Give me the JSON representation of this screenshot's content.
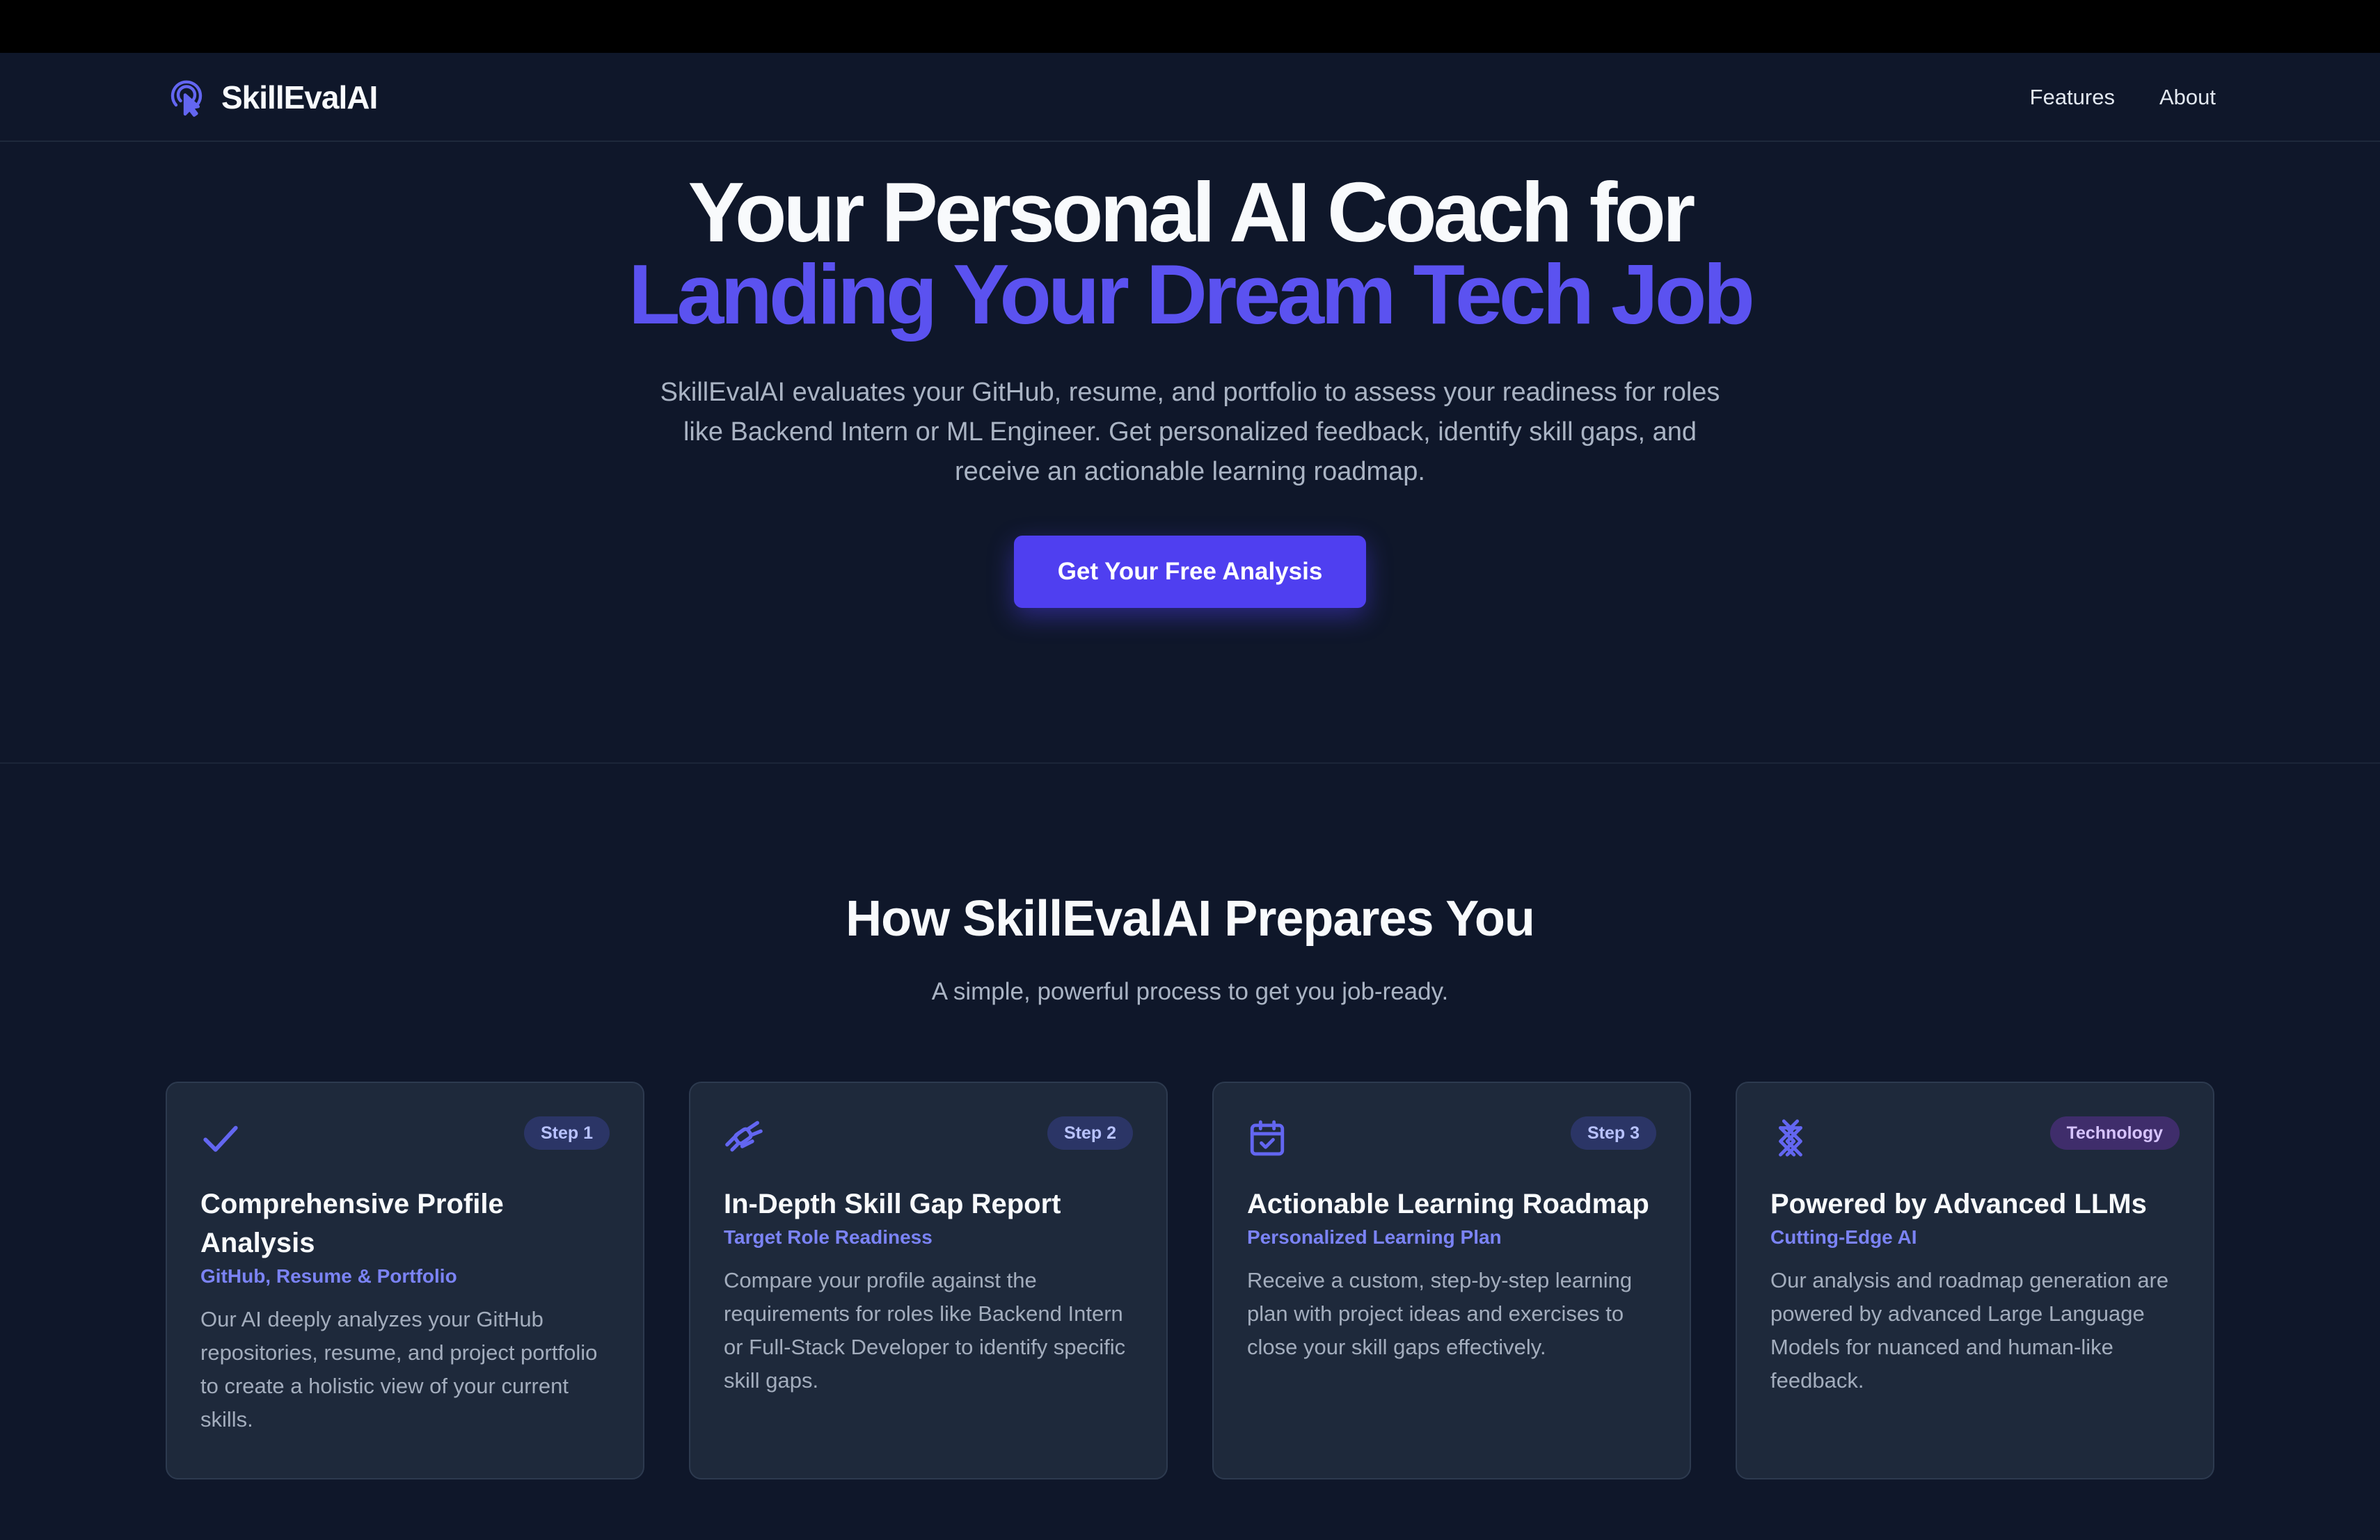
{
  "brand": {
    "name": "SkillEvalAI",
    "accent": "#5b52f0"
  },
  "nav": {
    "features": "Features",
    "about": "About"
  },
  "hero": {
    "title_line1": "Your Personal AI Coach for",
    "title_line2": "Landing Your Dream Tech Job",
    "subtitle": "SkillEvalAI evaluates your GitHub, resume, and portfolio to assess your readiness for roles like Backend Intern or ML Engineer. Get personalized feedback, identify skill gaps, and receive an actionable learning roadmap.",
    "cta": "Get Your Free Analysis"
  },
  "section": {
    "title": "How SkillEvalAI Prepares You",
    "subtitle": "A simple, powerful process to get you job-ready."
  },
  "cards": [
    {
      "icon": "check-icon",
      "badge": "Step 1",
      "title": "Comprehensive Profile Analysis",
      "subtitle": "GitHub, Resume & Portfolio",
      "body": "Our AI deeply analyzes your GitHub repositories, resume, and project portfolio to create a holistic view of your current skills."
    },
    {
      "icon": "satellite-icon",
      "badge": "Step 2",
      "title": "In-Depth Skill Gap Report",
      "subtitle": "Target Role Readiness",
      "body": "Compare your profile against the requirements for roles like Backend Intern or Full-Stack Developer to identify specific skill gaps."
    },
    {
      "icon": "calendar-check-icon",
      "badge": "Step 3",
      "title": "Actionable Learning Roadmap",
      "subtitle": "Personalized Learning Plan",
      "body": "Receive a custom, step-by-step learning plan with project ideas and exercises to close your skill gaps effectively."
    },
    {
      "icon": "neural-lattice-icon",
      "badge": "Technology",
      "title": "Powered by Advanced LLMs",
      "subtitle": "Cutting-Edge AI",
      "body": "Our analysis and roadmap generation are powered by advanced Large Language Models for nuanced and human-like feedback."
    }
  ]
}
